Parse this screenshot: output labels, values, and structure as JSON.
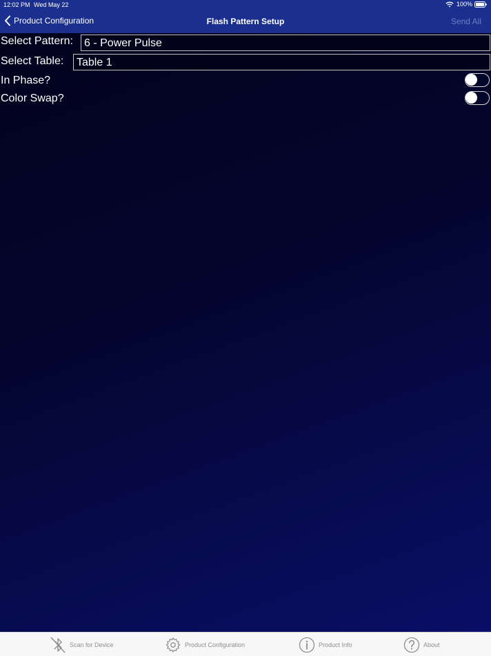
{
  "status_bar": {
    "time": "12:02 PM",
    "date": "Wed May 22",
    "battery": "100%"
  },
  "nav": {
    "back_label": "Product Configuration",
    "title": "Flash Pattern Setup",
    "send_all_label": "Send All"
  },
  "form": {
    "pattern_label": "Select Pattern:",
    "pattern_value": "6 - Power Pulse",
    "table_label": "Select Table:",
    "table_value": "Table 1",
    "in_phase_label": "In Phase?",
    "in_phase_on": false,
    "color_swap_label": "Color Swap?",
    "color_swap_on": false
  },
  "tabs": [
    {
      "label": "Scan for Device",
      "icon": "bluetooth-off-icon"
    },
    {
      "label": "Product Configuration",
      "icon": "gear-icon"
    },
    {
      "label": "Product Info",
      "icon": "info-icon"
    },
    {
      "label": "About",
      "icon": "question-icon"
    }
  ],
  "colors": {
    "header": "#1b2f8f",
    "send_all": "#6f7ec2",
    "tab_text": "#8e8e8e"
  }
}
